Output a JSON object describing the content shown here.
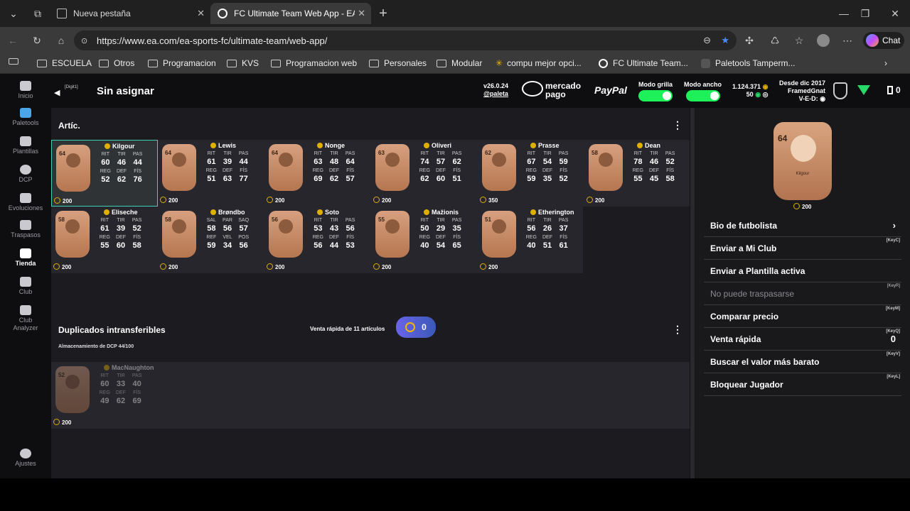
{
  "browser": {
    "tabs": [
      {
        "title": "Nueva pestaña"
      },
      {
        "title": "FC Ultimate Team Web App - EA S"
      }
    ],
    "url": "https://www.ea.com/ea-sports-fc/ultimate-team/web-app/",
    "chat_label": "Chat",
    "bookmarks": [
      "ESCUELA",
      "Otros",
      "Programacion",
      "KVS",
      "Programacion web",
      "Personales",
      "Modular",
      "compu mejor opci...",
      "FC Ultimate Team...",
      "Paletools Tamperm..."
    ]
  },
  "nav": {
    "items": [
      {
        "label": "Inicio"
      },
      {
        "label": "Paletools"
      },
      {
        "label": "Plantillas"
      },
      {
        "label": "DCP"
      },
      {
        "label": "Evoluciones"
      },
      {
        "label": "Traspasos"
      },
      {
        "label": "Tienda"
      },
      {
        "label": "Club"
      },
      {
        "label": "Club Analyzer"
      },
      {
        "label": "Ajustes"
      }
    ]
  },
  "header": {
    "tag": "[Digit1]",
    "title": "Sin asignar",
    "version": "v26.0.24",
    "handle": "@paleta",
    "mp_line1": "mercado",
    "mp_line2": "pago",
    "paypal": "PayPal",
    "mode_grid": "Modo grilla",
    "mode_wide": "Modo ancho",
    "coins": "1.124.371",
    "points": "50",
    "since": "Desde dic 2017",
    "club_name": "FramedGnat",
    "ved": "V-E-D:",
    "counter": "0"
  },
  "items": {
    "title": "Artíc.",
    "quick_sell_label": "Venta rápida de 11 artículos",
    "quick_sell_value": "0",
    "players": [
      {
        "name": "Kilgour",
        "ovr": "64",
        "labels1": [
          "RIT",
          "TIR",
          "PAS"
        ],
        "vals1": [
          "60",
          "46",
          "44"
        ],
        "labels2": [
          "REG",
          "DEF",
          "FÍS"
        ],
        "vals2": [
          "52",
          "62",
          "76"
        ],
        "price": "200"
      },
      {
        "name": "Lewis",
        "ovr": "64",
        "labels1": [
          "RIT",
          "TIR",
          "PAS"
        ],
        "vals1": [
          "61",
          "39",
          "44"
        ],
        "labels2": [
          "REG",
          "DEF",
          "FÍS"
        ],
        "vals2": [
          "51",
          "63",
          "77"
        ],
        "price": "200"
      },
      {
        "name": "Nonge",
        "ovr": "64",
        "labels1": [
          "RIT",
          "TIR",
          "PAS"
        ],
        "vals1": [
          "63",
          "48",
          "64"
        ],
        "labels2": [
          "REG",
          "DEF",
          "FÍS"
        ],
        "vals2": [
          "69",
          "62",
          "57"
        ],
        "price": "200"
      },
      {
        "name": "Oliveri",
        "ovr": "63",
        "labels1": [
          "RIT",
          "TIR",
          "PAS"
        ],
        "vals1": [
          "74",
          "57",
          "62"
        ],
        "labels2": [
          "REG",
          "DEF",
          "FÍS"
        ],
        "vals2": [
          "62",
          "60",
          "51"
        ],
        "price": "200"
      },
      {
        "name": "Prasse",
        "ovr": "62",
        "labels1": [
          "RIT",
          "TIR",
          "PAS"
        ],
        "vals1": [
          "67",
          "54",
          "59"
        ],
        "labels2": [
          "REG",
          "DEF",
          "FÍS"
        ],
        "vals2": [
          "59",
          "35",
          "52"
        ],
        "price": "350"
      },
      {
        "name": "Dean",
        "ovr": "58",
        "labels1": [
          "RIT",
          "TIR",
          "PAS"
        ],
        "vals1": [
          "78",
          "46",
          "52"
        ],
        "labels2": [
          "REG",
          "DEF",
          "FÍS"
        ],
        "vals2": [
          "55",
          "45",
          "58"
        ],
        "price": "200"
      },
      {
        "name": "Eliseche",
        "ovr": "58",
        "labels1": [
          "RIT",
          "TIR",
          "PAS"
        ],
        "vals1": [
          "61",
          "39",
          "52"
        ],
        "labels2": [
          "REG",
          "DEF",
          "FÍS"
        ],
        "vals2": [
          "55",
          "60",
          "58"
        ],
        "price": "200"
      },
      {
        "name": "Brøndbo",
        "ovr": "58",
        "labels1": [
          "SAL",
          "PAR",
          "SAQ"
        ],
        "vals1": [
          "58",
          "56",
          "57"
        ],
        "labels2": [
          "REF",
          "VEL",
          "POS"
        ],
        "vals2": [
          "59",
          "34",
          "56"
        ],
        "price": "200"
      },
      {
        "name": "Soto",
        "ovr": "56",
        "labels1": [
          "RIT",
          "TIR",
          "PAS"
        ],
        "vals1": [
          "53",
          "43",
          "56"
        ],
        "labels2": [
          "REG",
          "DEF",
          "FÍS"
        ],
        "vals2": [
          "56",
          "44",
          "53"
        ],
        "price": "200"
      },
      {
        "name": "Mažionis",
        "ovr": "55",
        "labels1": [
          "RIT",
          "TIR",
          "PAS"
        ],
        "vals1": [
          "50",
          "29",
          "35"
        ],
        "labels2": [
          "REG",
          "DEF",
          "FÍS"
        ],
        "vals2": [
          "40",
          "54",
          "65"
        ],
        "price": "200"
      },
      {
        "name": "Etherington",
        "ovr": "51",
        "labels1": [
          "RIT",
          "TIR",
          "PAS"
        ],
        "vals1": [
          "56",
          "26",
          "37"
        ],
        "labels2": [
          "REG",
          "DEF",
          "FÍS"
        ],
        "vals2": [
          "40",
          "51",
          "61"
        ],
        "price": "200"
      }
    ]
  },
  "duplicates": {
    "title": "Duplicados intransferibles",
    "storage": "Almacenamiento de DCP 44/100",
    "player": {
      "name": "MacNaughton",
      "ovr": "52",
      "labels1": [
        "RIT",
        "TIR",
        "PAS"
      ],
      "vals1": [
        "60",
        "33",
        "40"
      ],
      "labels2": [
        "REG",
        "DEF",
        "FÍS"
      ],
      "vals2": [
        "49",
        "62",
        "69"
      ],
      "price": "200"
    }
  },
  "detail": {
    "card_ovr": "64",
    "card_name": "Kilgour",
    "price": "200",
    "menu": [
      {
        "label": "Bio de futbolista",
        "kb": "",
        "right": "›"
      },
      {
        "label": "Enviar a Mi Club",
        "kb": "[KeyC]",
        "right": ""
      },
      {
        "label": "Enviar a Plantilla activa",
        "kb": "",
        "right": ""
      },
      {
        "label": "No puede traspasarse",
        "kb": "[KeyR]",
        "right": ""
      },
      {
        "label": "Comparar precio",
        "kb": "[KeyM]",
        "right": ""
      },
      {
        "label": "Venta rápida",
        "kb": "[KeyQ]",
        "right": "0"
      },
      {
        "label": "Buscar el valor más barato",
        "kb": "[KeyV]",
        "right": ""
      },
      {
        "label": "Bloquear Jugador",
        "kb": "[KeyL]",
        "right": ""
      }
    ]
  }
}
